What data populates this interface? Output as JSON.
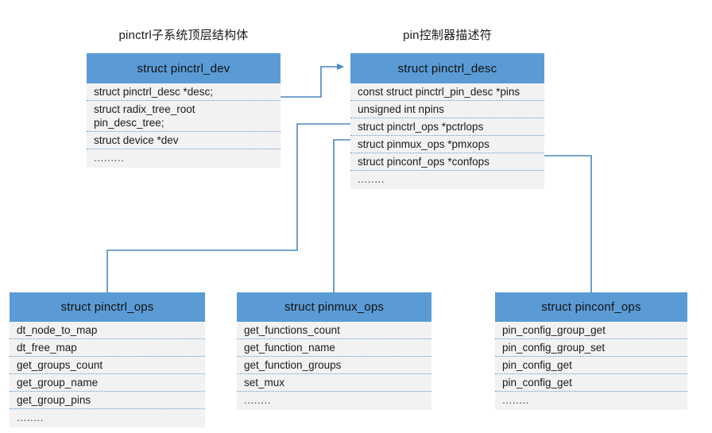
{
  "diagram": {
    "title_top_left": "pinctrl子系统顶层结构体",
    "title_top_right": "pin控制器描述符",
    "accent_color": "#5B9BD5",
    "body_color": "#f2f2f2",
    "connector_color": "#4a87bf"
  },
  "boxes": {
    "pinctrl_dev": {
      "header": "struct pinctrl_dev",
      "fields": [
        "struct pinctrl_desc *desc;",
        "struct radix_tree_root\npin_desc_tree;",
        "struct device *dev",
        "........."
      ]
    },
    "pinctrl_desc": {
      "header": "struct pinctrl_desc",
      "fields": [
        "const struct pinctrl_pin_desc *pins",
        "unsigned int npins",
        "struct pinctrl_ops *pctrlops",
        "struct pinmux_ops *pmxops",
        "struct pinconf_ops *confops",
        "........"
      ]
    },
    "pinctrl_ops": {
      "header": "struct pinctrl_ops",
      "fields": [
        "dt_node_to_map",
        "dt_free_map",
        "get_groups_count",
        "get_group_name",
        "get_group_pins",
        "........"
      ]
    },
    "pinmux_ops": {
      "header": "struct pinmux_ops",
      "fields": [
        "get_functions_count",
        "get_function_name",
        "get_function_groups",
        "set_mux",
        "........"
      ]
    },
    "pinconf_ops": {
      "header": "struct pinconf_ops",
      "fields": [
        "pin_config_group_get",
        "pin_config_group_set",
        "pin_config_get",
        "pin_config_get",
        "........"
      ]
    }
  }
}
